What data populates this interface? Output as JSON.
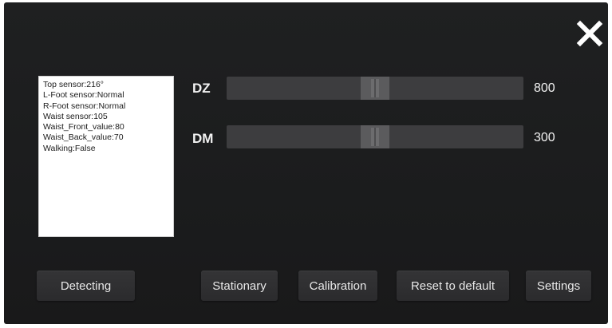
{
  "close_icon": "close-icon",
  "status_panel": {
    "lines": [
      "Top sensor:216°",
      "L-Foot sensor:Normal",
      "R-Foot sensor:Normal",
      "Waist sensor:105",
      "Waist_Front_value:80",
      "Waist_Back_value:70",
      "Walking:False"
    ]
  },
  "sliders": {
    "dz": {
      "label": "DZ",
      "value": "800",
      "position": 0.5
    },
    "dm": {
      "label": "DM",
      "value": "300",
      "position": 0.5
    }
  },
  "buttons": {
    "detecting": "Detecting",
    "stationary": "Stationary",
    "calibration": "Calibration",
    "reset": "Reset to default",
    "settings": "Settings"
  },
  "colors": {
    "background": "#1d1e1f",
    "track": "#3d3d3f",
    "thumb": "#5b5b5d",
    "button": "#2f2f31",
    "text": "#f2f2f2"
  }
}
